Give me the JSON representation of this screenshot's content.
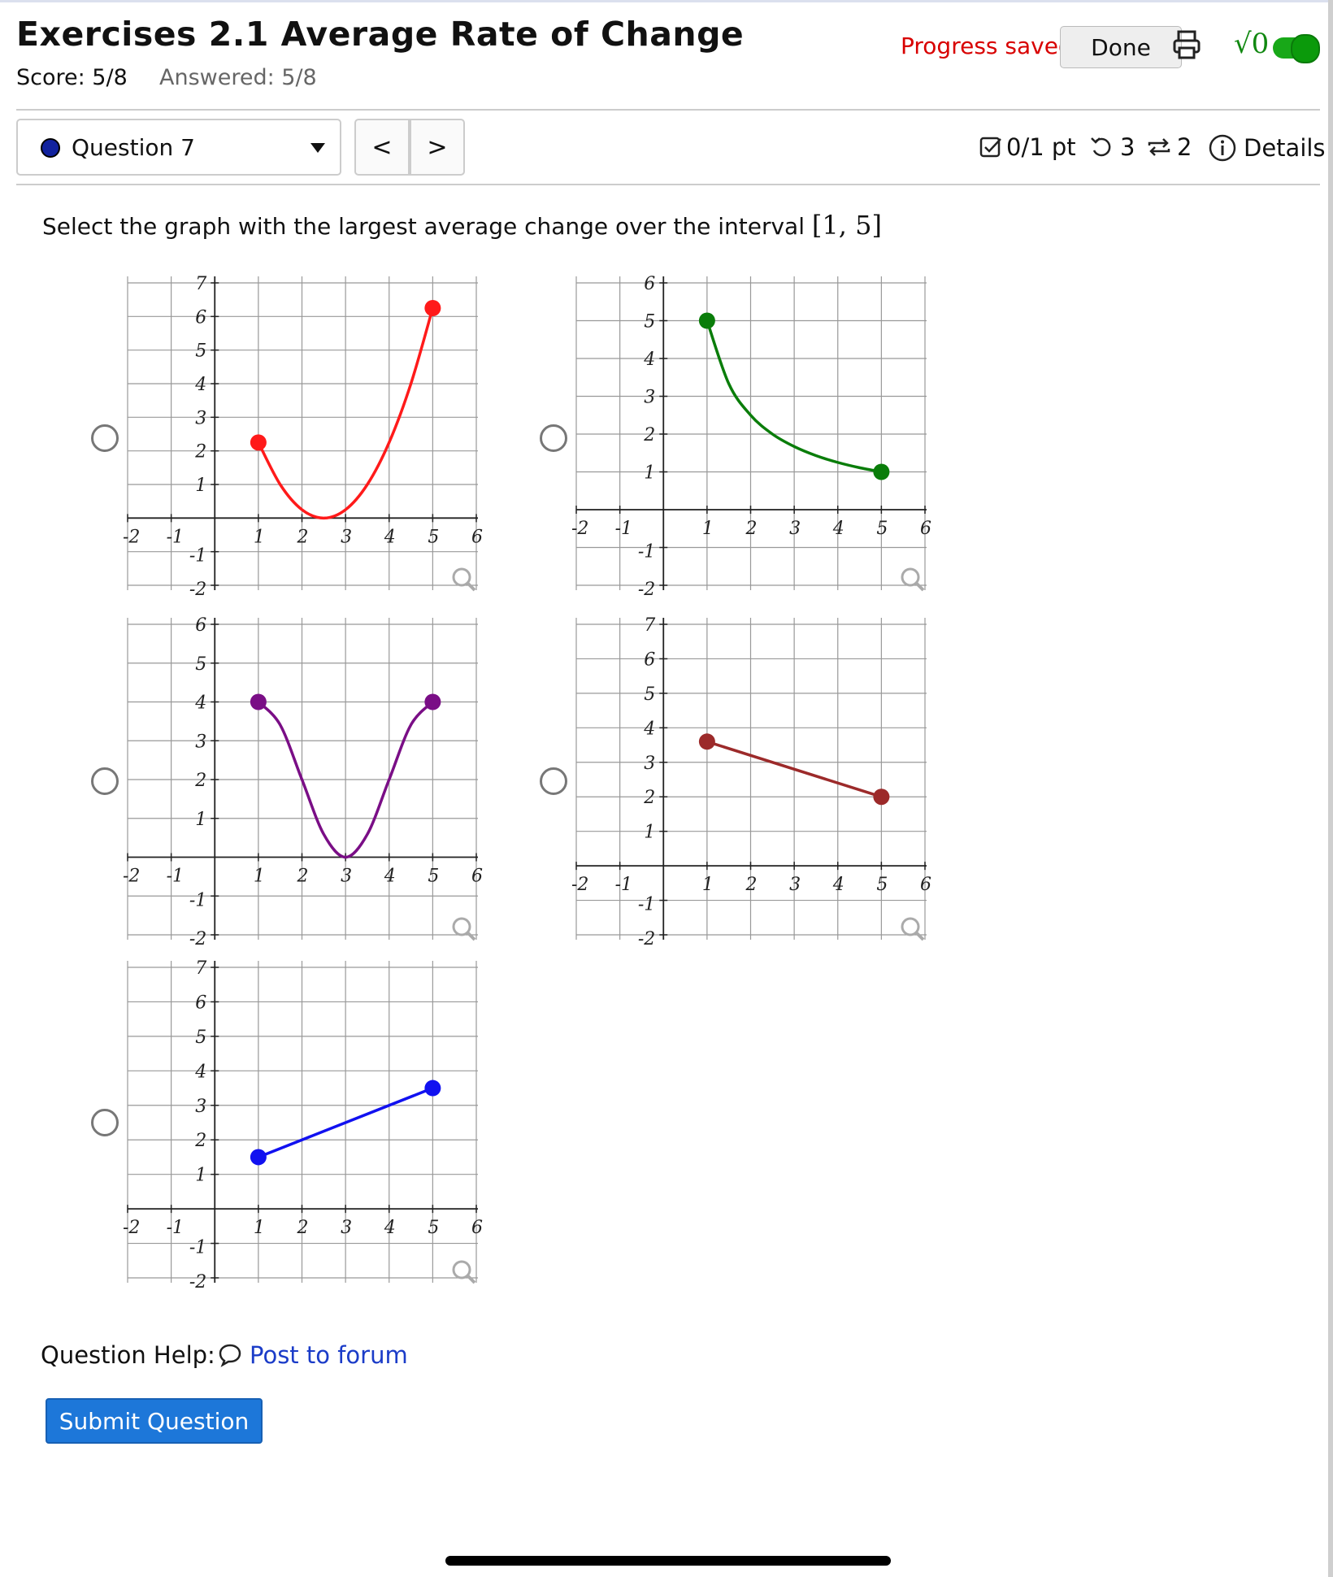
{
  "header": {
    "title": "Exercises 2.1 Average Rate of Change",
    "score": "Score: 5/8",
    "answered": "Answered: 5/8",
    "progress": "Progress saved",
    "done_label": "Done",
    "sqrt_label": "√0"
  },
  "toolbar": {
    "question_label": "Question 7",
    "prev_label": "<",
    "next_label": ">",
    "points": "0/1 pt",
    "retries": "3",
    "attempts": "2",
    "details": "Details"
  },
  "question": {
    "prompt": "Select the graph with the largest average change over the interval ",
    "interval": "[1, 5]"
  },
  "footer": {
    "help_label": "Question Help:",
    "forum_label": "Post to forum",
    "submit_label": "Submit Question"
  },
  "icons": {
    "print": "printer-icon",
    "magnify": "magnifier-icon",
    "forum": "speech-bubble-icon",
    "points": "checkbox-icon",
    "retries": "undo-icon",
    "attempts": "repeat-icon",
    "details": "info-icon"
  },
  "colors": {
    "graph_a": "#ff1a1a",
    "graph_b": "#0a7d0a",
    "graph_c": "#7a0e86",
    "graph_d": "#9c2a2a",
    "graph_e": "#1111f0",
    "submit": "#1d77d9",
    "progress": "#d80000"
  },
  "chart_data": [
    {
      "type": "line",
      "name": "graph-a",
      "xticks": [
        "-2",
        "-1",
        "1",
        "2",
        "3",
        "4",
        "5",
        "6"
      ],
      "yticks": [
        "7",
        "6",
        "5",
        "4",
        "3",
        "2",
        "1",
        "-1",
        "-2"
      ],
      "xlim": [
        -2,
        6
      ],
      "ylim": [
        -2,
        7
      ],
      "points": [
        [
          1,
          2.25
        ],
        [
          1.5,
          1
        ],
        [
          2,
          0.25
        ],
        [
          2.5,
          0
        ],
        [
          3,
          0.25
        ],
        [
          3.5,
          1
        ],
        [
          4,
          2.25
        ],
        [
          4.5,
          4
        ],
        [
          5,
          6.25
        ]
      ],
      "endpoints": [
        [
          1,
          2.25
        ],
        [
          5,
          6.25
        ]
      ],
      "color": "#ff1a1a"
    },
    {
      "type": "line",
      "name": "graph-b",
      "xticks": [
        "-2",
        "-1",
        "1",
        "2",
        "3",
        "4",
        "5",
        "6"
      ],
      "yticks": [
        "6",
        "5",
        "4",
        "3",
        "2",
        "1",
        "-1",
        "-2"
      ],
      "xlim": [
        -2,
        6
      ],
      "ylim": [
        -2,
        6
      ],
      "points": [
        [
          1,
          5
        ],
        [
          1.5,
          3.33
        ],
        [
          2,
          2.5
        ],
        [
          2.5,
          2
        ],
        [
          3,
          1.67
        ],
        [
          3.5,
          1.43
        ],
        [
          4,
          1.25
        ],
        [
          4.5,
          1.11
        ],
        [
          5,
          1
        ]
      ],
      "endpoints": [
        [
          1,
          5
        ],
        [
          5,
          1
        ]
      ],
      "color": "#0a7d0a"
    },
    {
      "type": "line",
      "name": "graph-c",
      "xticks": [
        "-2",
        "-1",
        "1",
        "2",
        "3",
        "4",
        "5",
        "6"
      ],
      "yticks": [
        "6",
        "5",
        "4",
        "3",
        "2",
        "1",
        "-1",
        "-2"
      ],
      "xlim": [
        -2,
        6
      ],
      "ylim": [
        -2,
        6
      ],
      "points": [
        [
          1,
          4
        ],
        [
          1.5,
          3.41
        ],
        [
          2,
          2
        ],
        [
          2.5,
          0.59
        ],
        [
          3,
          0
        ],
        [
          3.5,
          0.59
        ],
        [
          4,
          2
        ],
        [
          4.5,
          3.41
        ],
        [
          5,
          4
        ]
      ],
      "endpoints": [
        [
          1,
          4
        ],
        [
          5,
          4
        ]
      ],
      "color": "#7a0e86"
    },
    {
      "type": "line",
      "name": "graph-d",
      "xticks": [
        "-2",
        "-1",
        "1",
        "2",
        "3",
        "4",
        "5",
        "6"
      ],
      "yticks": [
        "7",
        "6",
        "5",
        "4",
        "3",
        "2",
        "1",
        "-1",
        "-2"
      ],
      "xlim": [
        -2,
        6
      ],
      "ylim": [
        -2,
        7
      ],
      "points": [
        [
          1,
          3.6
        ],
        [
          5,
          2
        ]
      ],
      "endpoints": [
        [
          1,
          3.6
        ],
        [
          5,
          2
        ]
      ],
      "color": "#9c2a2a"
    },
    {
      "type": "line",
      "name": "graph-e",
      "xticks": [
        "-2",
        "-1",
        "1",
        "2",
        "3",
        "4",
        "5",
        "6"
      ],
      "yticks": [
        "7",
        "6",
        "5",
        "4",
        "3",
        "2",
        "1",
        "-1",
        "-2"
      ],
      "xlim": [
        -2,
        6
      ],
      "ylim": [
        -2,
        7
      ],
      "points": [
        [
          1,
          1.5
        ],
        [
          5,
          3.5
        ]
      ],
      "endpoints": [
        [
          1,
          1.5
        ],
        [
          5,
          3.5
        ]
      ],
      "color": "#1111f0"
    }
  ]
}
